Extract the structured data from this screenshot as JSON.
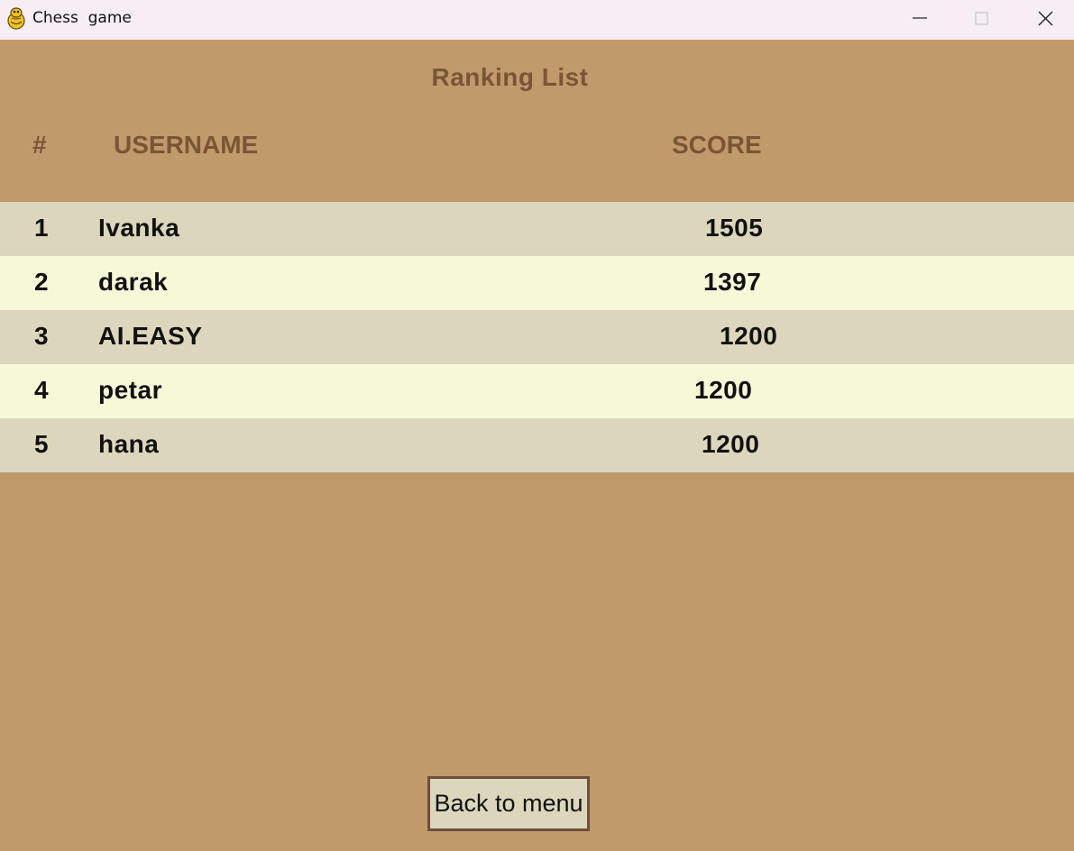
{
  "window": {
    "title": "Chess  game",
    "app_icon": "python-snake-icon",
    "controls": [
      "minimize-icon",
      "maximize-icon",
      "close-icon"
    ]
  },
  "page": {
    "heading": "Ranking List",
    "columns": {
      "rank": "#",
      "username": "USERNAME",
      "score": "SCORE"
    },
    "rows": [
      {
        "rank": "1",
        "username": "Ivanka",
        "score": "1505"
      },
      {
        "rank": "2",
        "username": "darak",
        "score": "1397"
      },
      {
        "rank": "3",
        "username": "AI.EASY",
        "score": "1200"
      },
      {
        "rank": "4",
        "username": "petar",
        "score": "1200"
      },
      {
        "rank": "5",
        "username": "hana",
        "score": "1200"
      }
    ],
    "back_button": "Back to menu"
  },
  "colors": {
    "background": "#c09a6b",
    "header_text": "#7a5535",
    "row_dark": "#dcd7bc",
    "row_light": "#f6f9d8",
    "button_border": "#6e4f3a"
  }
}
